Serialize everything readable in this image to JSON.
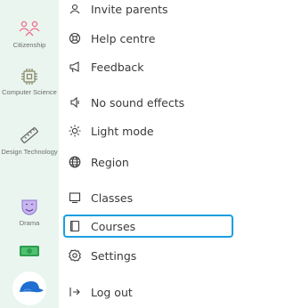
{
  "sidebar": {
    "items": [
      {
        "label": "Citizenship",
        "icon": "people-network-icon"
      },
      {
        "label": "Computer Science",
        "icon": "chip-icon"
      },
      {
        "label": "Design Technology",
        "icon": "ruler-icon"
      },
      {
        "label": "Drama",
        "icon": "theatre-mask-icon"
      },
      {
        "label": "",
        "icon": "money-icon"
      },
      {
        "label": "",
        "icon": "cap-icon"
      }
    ]
  },
  "menu": {
    "items": [
      {
        "label": "Invite parents",
        "icon": "invite-icon"
      },
      {
        "label": "Help centre",
        "icon": "help-icon"
      },
      {
        "label": "Feedback",
        "icon": "megaphone-icon"
      },
      {
        "label": "No sound effects",
        "icon": "speaker-icon"
      },
      {
        "label": "Light mode",
        "icon": "sun-icon"
      },
      {
        "label": "Region",
        "icon": "globe-icon"
      },
      {
        "label": "Classes",
        "icon": "board-icon"
      },
      {
        "label": "Courses",
        "icon": "book-icon",
        "active": true
      },
      {
        "label": "Settings",
        "icon": "gear-icon"
      },
      {
        "label": "Log out",
        "icon": "logout-icon"
      }
    ]
  },
  "colors": {
    "accent": "#1a9fe0",
    "rail": "#eaf5f0",
    "text": "#3a3a3a"
  }
}
